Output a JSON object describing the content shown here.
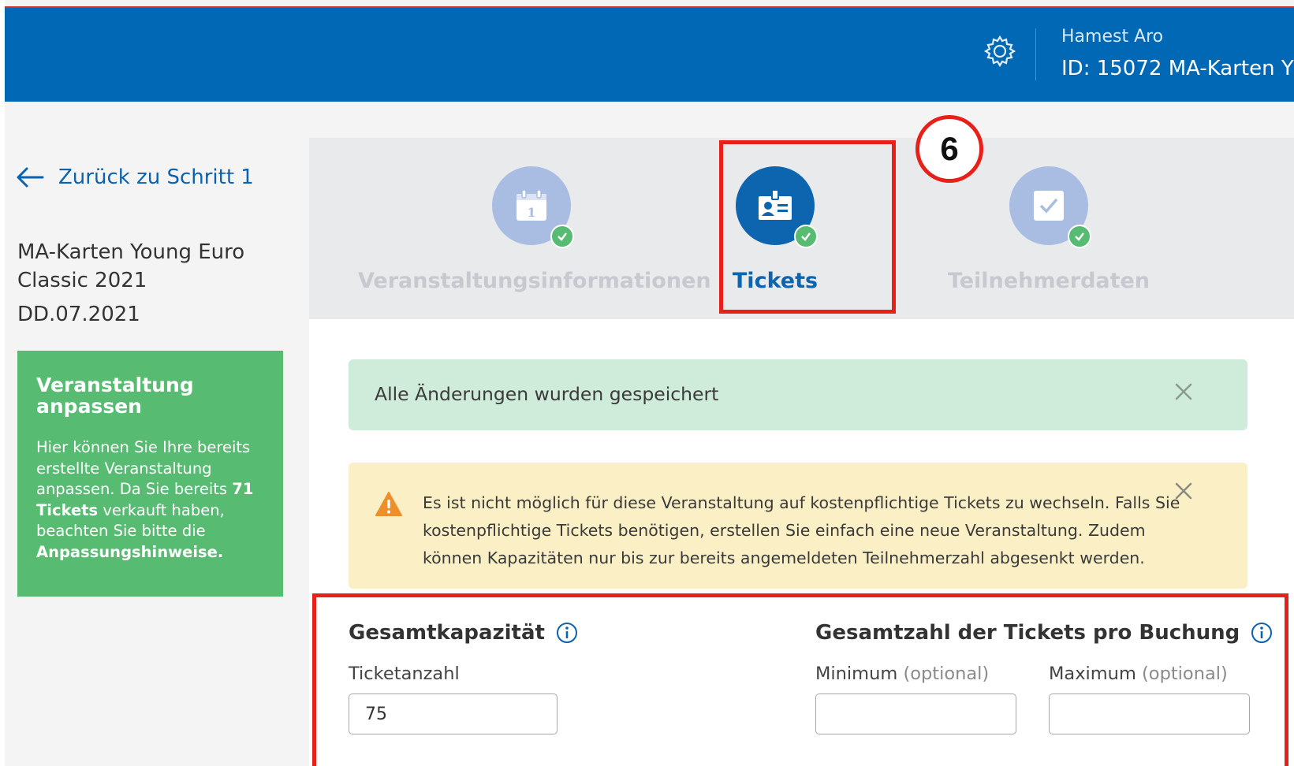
{
  "header": {
    "user_name": "Hamest Aro",
    "user_id_line": "ID: 15072   MA-Karten Y",
    "icon": "gear-icon",
    "color": "#0068b5"
  },
  "sidebar": {
    "back_label": "Zurück zu Schritt 1",
    "event_title": "MA-Karten Young Euro Classic 2021",
    "event_date": "DD.07.2021",
    "card": {
      "title": "Veranstaltung anpassen",
      "text_1": "Hier können Sie Ihre bereits erstellte Veranstaltung anpassen. Da Sie bereits ",
      "count": "71",
      "text_2": "Tickets",
      "text_3": " verkauft haben, beachten Sie bitte die ",
      "text_4": "Anpassungshinweise.",
      "color": "#57bb72"
    }
  },
  "steps": [
    {
      "label": "Veranstaltungsinformationen",
      "icon": "calendar-icon",
      "state": "done"
    },
    {
      "label": "Tickets",
      "icon": "ticket-icon",
      "state": "active"
    },
    {
      "label": "Teilnehmerdaten",
      "icon": "checkbox-icon",
      "state": "done"
    }
  ],
  "annotation": {
    "marker": "6"
  },
  "alerts": {
    "success": "Alle Änderungen wurden gespeichert",
    "warning": "Es ist nicht möglich für diese Veranstaltung auf kostenpflichtige Tickets zu wechseln. Falls Sie kostenpflichtige Tickets benötigen, erstellen Sie einfach eine neue Veranstaltung. Zudem können Kapazitäten nur bis zur bereits angemeldeten Teilnehmerzahl abgesenkt werden."
  },
  "form": {
    "capacity": {
      "title": "Gesamtkapazität",
      "label": "Ticketanzahl",
      "value": "75"
    },
    "per_booking": {
      "title": "Gesamtzahl der Tickets pro Buchung",
      "min_label": "Minimum",
      "max_label": "Maximum",
      "optional": "(optional)",
      "min_value": "",
      "max_value": ""
    }
  }
}
